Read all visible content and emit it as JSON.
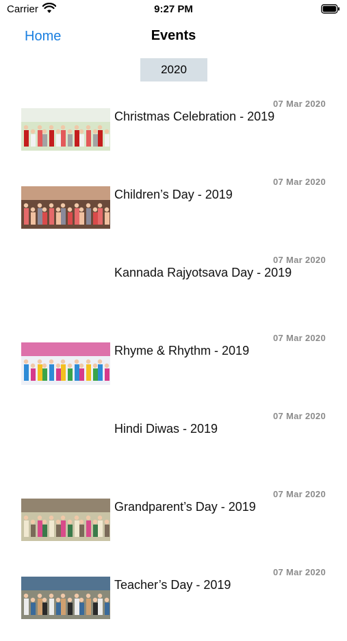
{
  "status_bar": {
    "carrier": "Carrier",
    "time": "9:27 PM",
    "icons": [
      "wifi-icon",
      "battery-icon"
    ]
  },
  "nav": {
    "back_label": "Home",
    "title": "Events",
    "accent_color": "#1a7fe0"
  },
  "year_filter": {
    "selected": "2020"
  },
  "events": [
    {
      "title": "Christmas Celebration - 2019",
      "date": "07 Mar 2020",
      "has_image": true
    },
    {
      "title": "Children’s Day - 2019",
      "date": "07 Mar 2020",
      "has_image": true
    },
    {
      "title": "Kannada Rajyotsava Day - 2019",
      "date": "07 Mar 2020",
      "has_image": false
    },
    {
      "title": "Rhyme & Rhythm - 2019",
      "date": "07 Mar 2020",
      "has_image": true
    },
    {
      "title": "Hindi Diwas - 2019",
      "date": "07 Mar 2020",
      "has_image": false
    },
    {
      "title": "Grandparent’s Day - 2019",
      "date": "07 Mar 2020",
      "has_image": true
    },
    {
      "title": "Teacher’s Day - 2019",
      "date": "07 Mar 2020",
      "has_image": true
    }
  ]
}
